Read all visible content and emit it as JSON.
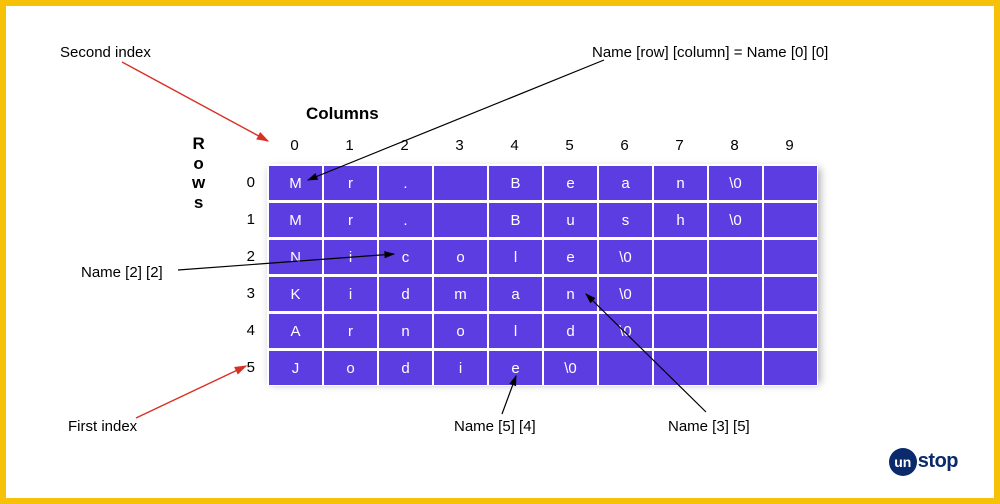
{
  "chart_data": {
    "type": "table",
    "title": "2D character array (array of strings)",
    "rows": 6,
    "cols": 10,
    "row_header_label": "Rows",
    "col_header_label": "Columns",
    "col_indices": [
      "0",
      "1",
      "2",
      "3",
      "4",
      "5",
      "6",
      "7",
      "8",
      "9"
    ],
    "row_indices": [
      "0",
      "1",
      "2",
      "3",
      "4",
      "5"
    ],
    "cells": [
      [
        "M",
        "r",
        ".",
        " ",
        "B",
        "e",
        "a",
        "n",
        "\\0",
        ""
      ],
      [
        "M",
        "r",
        ".",
        " ",
        "B",
        "u",
        "s",
        "h",
        "\\0",
        ""
      ],
      [
        "N",
        "i",
        "c",
        "o",
        "l",
        "e",
        "\\0",
        "",
        "",
        ""
      ],
      [
        "K",
        "i",
        "d",
        "m",
        "a",
        "n",
        "\\0",
        "",
        "",
        ""
      ],
      [
        "A",
        "r",
        "n",
        "o",
        "l",
        "d",
        "\\0",
        "",
        "",
        ""
      ],
      [
        "J",
        "o",
        "d",
        "i",
        "e",
        "\\0",
        "",
        "",
        "",
        ""
      ]
    ]
  },
  "annotations": {
    "second_index": "Second index",
    "first_index": "First index",
    "syntax": "Name [row] [column] = Name [0] [0]",
    "name22": "Name [2] [2]",
    "name54": "Name [5] [4]",
    "name35": "Name [3] [5]"
  },
  "logo": {
    "prefix": "un",
    "suffix": "stop"
  }
}
